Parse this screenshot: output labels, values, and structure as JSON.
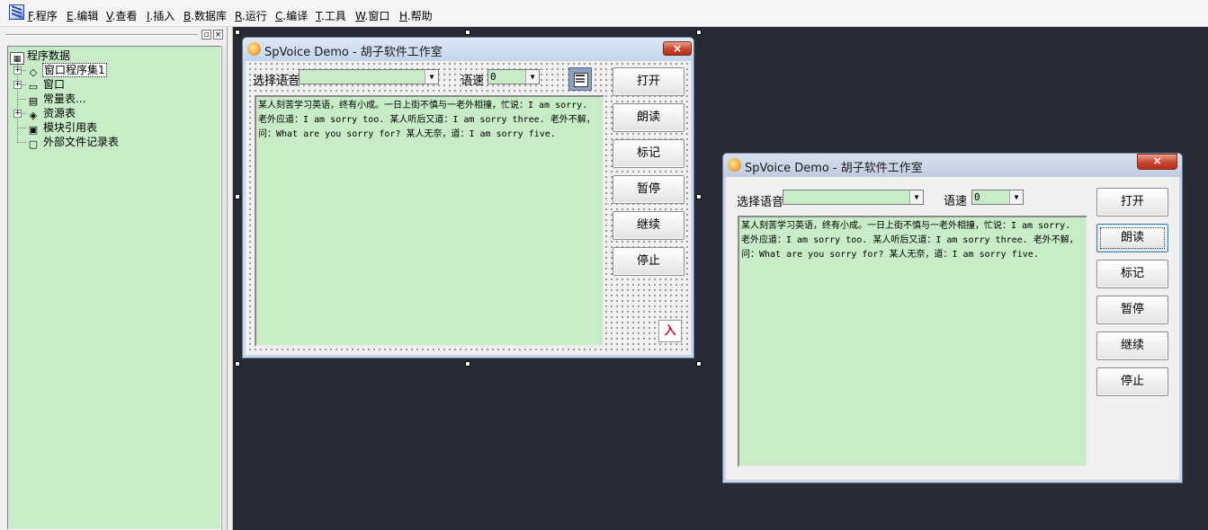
{
  "menubar": {
    "items": [
      {
        "key": "F",
        "label": ".程序"
      },
      {
        "key": "E",
        "label": ".编辑"
      },
      {
        "key": "V",
        "label": ".查看"
      },
      {
        "key": "I",
        "label": ".插入"
      },
      {
        "key": "B",
        "label": ".数据库"
      },
      {
        "key": "R",
        "label": ".运行"
      },
      {
        "key": "C",
        "label": ".编译"
      },
      {
        "key": "T",
        "label": ".工具"
      },
      {
        "key": "W",
        "label": ".窗口"
      },
      {
        "key": "H",
        "label": ".帮助"
      }
    ]
  },
  "panel": {
    "pin_glyph": "▫",
    "close_glyph": "×",
    "tree": {
      "root": "程序数据",
      "items": [
        {
          "label": "窗口程序集1",
          "expander": "+"
        },
        {
          "label": "窗口",
          "expander": "+"
        },
        {
          "label": "常量表...",
          "expander": ""
        },
        {
          "label": "资源表",
          "expander": "+"
        },
        {
          "label": "模块引用表",
          "expander": ""
        },
        {
          "label": "外部文件记录表",
          "expander": ""
        }
      ]
    }
  },
  "design_window": {
    "title": "SpVoice Demo - 胡子软件工作室",
    "voice_label": "选择语音",
    "voice_value": "",
    "rate_label": "语速",
    "rate_value": "0",
    "text": "某人刻苦学习英语，终有小成。一日上街不慎与一老外相撞，忙说：I am sorry. 老外应道：I am sorry too. 某人听后又道：I am sorry three. 老外不解，问：What are you sorry for? 某人无奈，道：I am sorry five.",
    "buttons": [
      "打开",
      "朗读",
      "标记",
      "暂停",
      "继续",
      "停止"
    ],
    "speech_control_label": "入"
  },
  "preview_window": {
    "title": "SpVoice Demo - 胡子软件工作室",
    "voice_label": "选择语音",
    "voice_value": "",
    "rate_label": "语速",
    "rate_value": "0",
    "text": "某人刻苦学习英语，终有小成。一日上街不慎与一老外相撞，忙说：I am sorry. 老外应道：I am sorry too. 某人听后又道：I am sorry three. 老外不解，问：What are you sorry for? 某人无奈，道：I am sorry five.",
    "buttons": [
      "打开",
      "朗读",
      "标记",
      "暂停",
      "继续",
      "停止"
    ],
    "focused_button_index": 1
  },
  "colors": {
    "editor_background": "#272b36",
    "control_green": "#c8ecc8",
    "close_red": "#c8452f",
    "titlebar": "#c2d4ec"
  },
  "icons": {
    "close": "×",
    "dropdown": "▼",
    "expand": "+"
  }
}
